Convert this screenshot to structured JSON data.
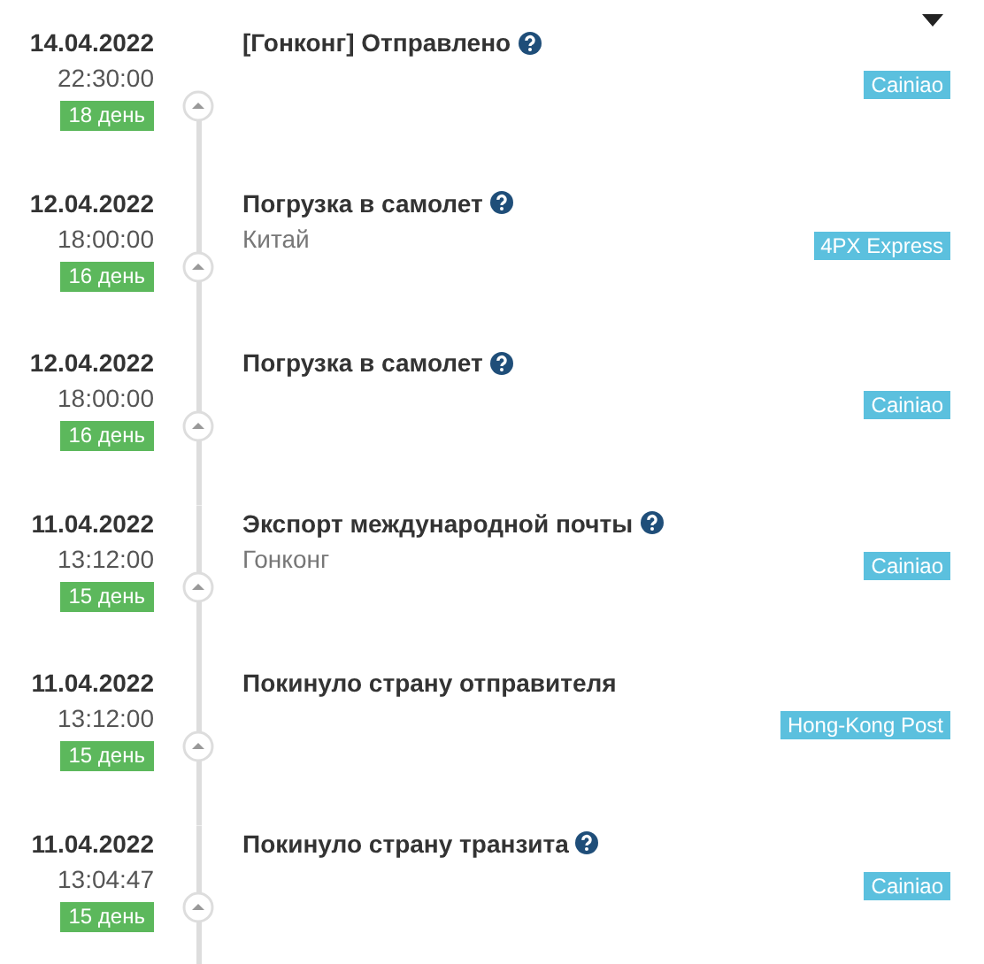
{
  "events": [
    {
      "date": "14.04.2022",
      "time": "22:30:00",
      "days": "18 день",
      "title": "[Гонконг] Отправлено",
      "help": true,
      "carrier": "Cainiao"
    },
    {
      "date": "12.04.2022",
      "time": "18:00:00",
      "days": "16 день",
      "title": "Погрузка в самолет",
      "help": true,
      "location": "Китай",
      "carrier": "4PX Express"
    },
    {
      "date": "12.04.2022",
      "time": "18:00:00",
      "days": "16 день",
      "title": "Погрузка в самолет",
      "help": true,
      "carrier": "Cainiao"
    },
    {
      "date": "11.04.2022",
      "time": "13:12:00",
      "days": "15 день",
      "title": "Экспорт международной почты",
      "help": true,
      "location": "Гонконг",
      "carrier": "Cainiao"
    },
    {
      "date": "11.04.2022",
      "time": "13:12:00",
      "days": "15 день",
      "title": "Покинуло страну отправителя",
      "help": false,
      "carrier": "Hong-Kong Post"
    },
    {
      "date": "11.04.2022",
      "time": "13:04:47",
      "days": "15 день",
      "title": "Покинуло страну транзита",
      "help": true,
      "carrier": "Cainiao"
    }
  ]
}
